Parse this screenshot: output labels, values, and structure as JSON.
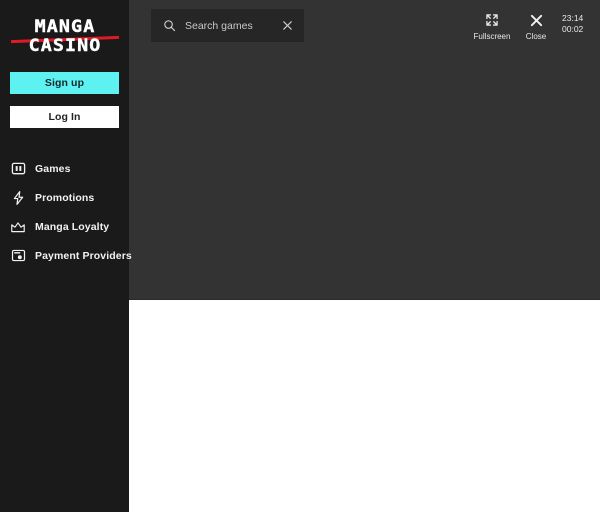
{
  "sidebar": {
    "logo": {
      "line1": "MANGA",
      "line2": "CASINO",
      "stripe_color": "#e01a24"
    },
    "buttons": {
      "signup_label": "Sign up",
      "signup_color": "#5ef1f1",
      "login_label": "Log In",
      "login_color": "#ffffff"
    },
    "nav": [
      {
        "label": "Games",
        "icon": "games-grid-icon"
      },
      {
        "label": "Promotions",
        "icon": "lightning-bolt-icon"
      },
      {
        "label": "Manga Loyalty",
        "icon": "crown-icon"
      },
      {
        "label": "Payment Providers",
        "icon": "payment-card-icon"
      }
    ]
  },
  "topbar": {
    "search": {
      "placeholder": "Search games",
      "value": "",
      "search_icon": "magnifier-icon",
      "clear_icon": "close-x-icon"
    },
    "actions": [
      {
        "label": "Fullscreen",
        "icon": "fullscreen-expand-icon"
      },
      {
        "label": "Close",
        "icon": "close-x-icon"
      }
    ],
    "clock": {
      "time": "23:14",
      "elapsed": "00:02"
    }
  },
  "colors": {
    "sidebar_bg": "#1a1a1a",
    "game_panel_bg": "#333333",
    "search_bg": "#262626",
    "content_bg": "#ffffff"
  }
}
